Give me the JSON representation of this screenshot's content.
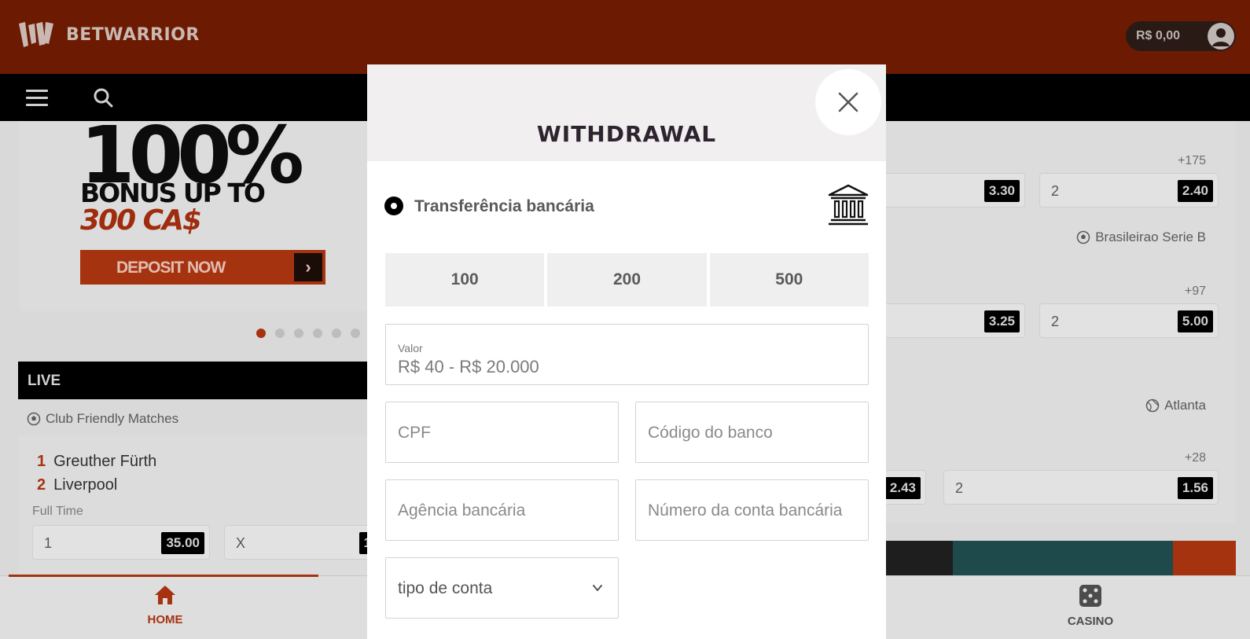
{
  "brand": {
    "name": "BETWARRIOR",
    "accent": "#a6330f",
    "header_bg": "#6d1a02"
  },
  "header": {
    "balance": "R$ 0,00"
  },
  "promo": {
    "headline": "100%",
    "bonus_line": "BONUS UP TO",
    "amount": "300 CA$",
    "cta": "DEPOSIT NOW",
    "cta_arrow": "›"
  },
  "live": {
    "section_label": "LIVE",
    "league": "Club Friendly Matches",
    "team1_num": "1",
    "team1": "Greuther Fürth",
    "team2_num": "2",
    "team2": "Liverpool",
    "status": "Full Time",
    "odds": [
      {
        "label": "1",
        "value": "35.00"
      },
      {
        "label": "X",
        "value": "1"
      }
    ]
  },
  "right": {
    "match1_more": "+175",
    "match1_odds": [
      {
        "label": "",
        "value": "3.30"
      },
      {
        "label": "2",
        "value": "2.40"
      }
    ],
    "league2": "Brasileirao Serie B",
    "match2_more": "+97",
    "match2_odds": [
      {
        "label": "",
        "value": "3.25"
      },
      {
        "label": "2",
        "value": "5.00"
      }
    ],
    "league3": "Atlanta",
    "match3_more": "+28",
    "match3_odds": [
      {
        "label": "",
        "value": "2.43"
      },
      {
        "label": "2",
        "value": "1.56"
      }
    ]
  },
  "bottom_nav": {
    "home": "HOME",
    "casino": "CASINO"
  },
  "modal": {
    "title": "WITHDRAWAL",
    "method": "Transferência bancária",
    "presets": [
      "100",
      "200",
      "500"
    ],
    "amount": {
      "label": "Valor",
      "placeholder": "R$ 40 - R$ 20.000"
    },
    "cpf_placeholder": "CPF",
    "bank_code_placeholder": "Código do banco",
    "agency_placeholder": "Agência bancária",
    "account_number_placeholder": "Número da conta bancária",
    "account_type": "tipo de conta"
  }
}
